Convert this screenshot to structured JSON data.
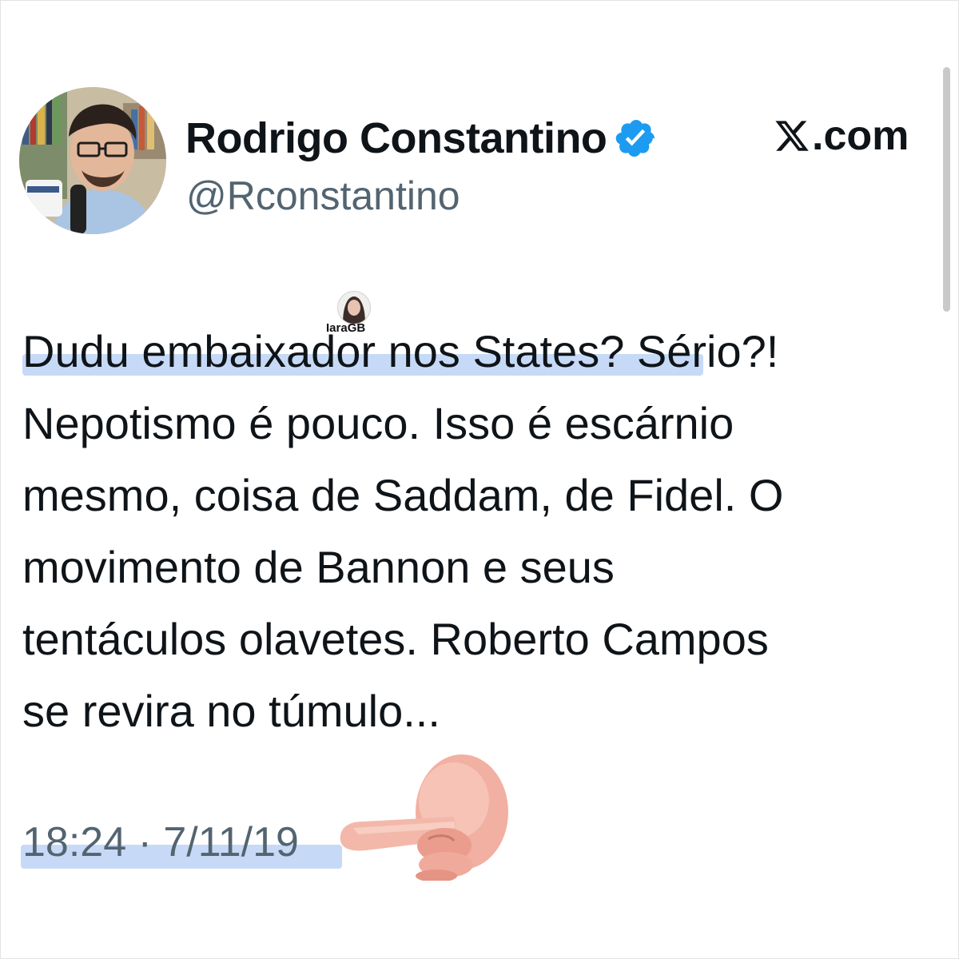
{
  "tweet": {
    "display_name": "Rodrigo Constantino",
    "handle": "@Rconstantino",
    "brand": ".com",
    "text": "Dudu embaixador nos States? Sério?!\nNepotismo é pouco. Isso é escárnio\nmesmo, coisa de Saddam, de Fidel. O\nmovimento de Bannon e seus\ntentáculos olavetes. Roberto Campos\nse revira no túmulo...",
    "timestamp": "18:24 · 7/11/19"
  },
  "watermark": {
    "name": "IaraGB"
  },
  "icons": {
    "verified": "verified-badge-icon",
    "x_logo": "x-logo-icon",
    "pointing": "pointing-hand-emoji"
  },
  "colors": {
    "verified_blue": "#1d9bf0",
    "handle_gray": "#536471",
    "highlight_blue": "#bcd3f6",
    "text": "#0f1419"
  }
}
